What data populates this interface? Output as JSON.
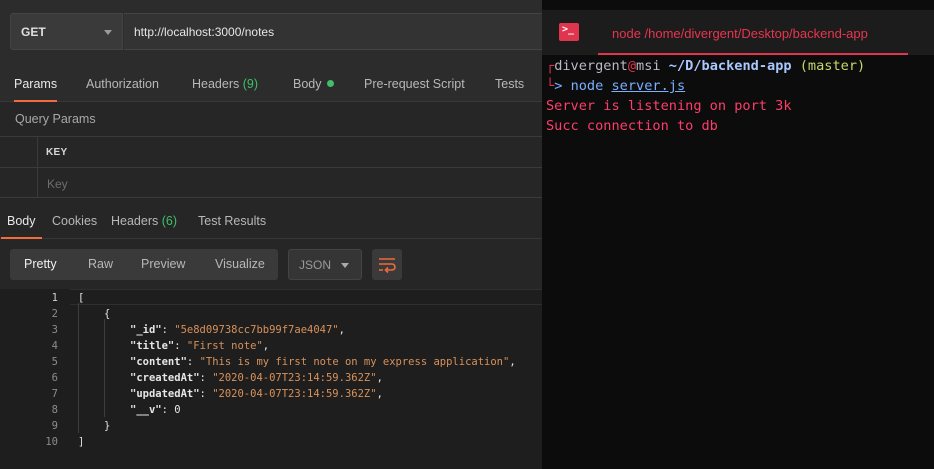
{
  "request": {
    "method": "GET",
    "url": "http://localhost:3000/notes"
  },
  "request_tabs": {
    "params": "Params",
    "authorization": "Authorization",
    "headers": "Headers",
    "headers_count": "(9)",
    "body": "Body",
    "prerequest": "Pre-request Script",
    "tests": "Tests"
  },
  "query_params": {
    "title": "Query Params",
    "key_header": "KEY",
    "key_placeholder": "Key"
  },
  "response_tabs": {
    "body": "Body",
    "cookies": "Cookies",
    "headers": "Headers",
    "headers_count": "(6)",
    "test_results": "Test Results"
  },
  "format": {
    "pretty": "Pretty",
    "raw": "Raw",
    "preview": "Preview",
    "visualize": "Visualize",
    "type": "JSON"
  },
  "code": {
    "line_numbers": [
      "1",
      "2",
      "3",
      "4",
      "5",
      "6",
      "7",
      "8",
      "9",
      "10"
    ],
    "l1": "[",
    "l2": "{",
    "id_key": "\"_id\"",
    "id_val": "\"5e8d09738cc7bb99f7ae4047\"",
    "title_key": "\"title\"",
    "title_val": "\"First note\"",
    "content_key": "\"content\"",
    "content_val": "\"This is my first note on my express application\"",
    "created_key": "\"createdAt\"",
    "created_val": "\"2020-04-07T23:14:59.362Z\"",
    "updated_key": "\"updatedAt\"",
    "updated_val": "\"2020-04-07T23:14:59.362Z\"",
    "v_key": "\"__v\"",
    "v_val": "0",
    "l9": "}",
    "l10": "]"
  },
  "terminal": {
    "icon": ">_",
    "title": "node /home/divergent/Desktop/backend-app",
    "user": "divergent",
    "at": "@",
    "host": "msi",
    "path": "~/D/backend-app",
    "branch": "(master)",
    "cmd": "node",
    "file": "server.js",
    "out1": "Server is listening on port 3k",
    "out2": "Succ connection to db"
  },
  "colors": {
    "accent": "#f26b3a",
    "green": "#3fbf6a",
    "terminal_red": "#e0354f",
    "string": "#d9915a"
  }
}
